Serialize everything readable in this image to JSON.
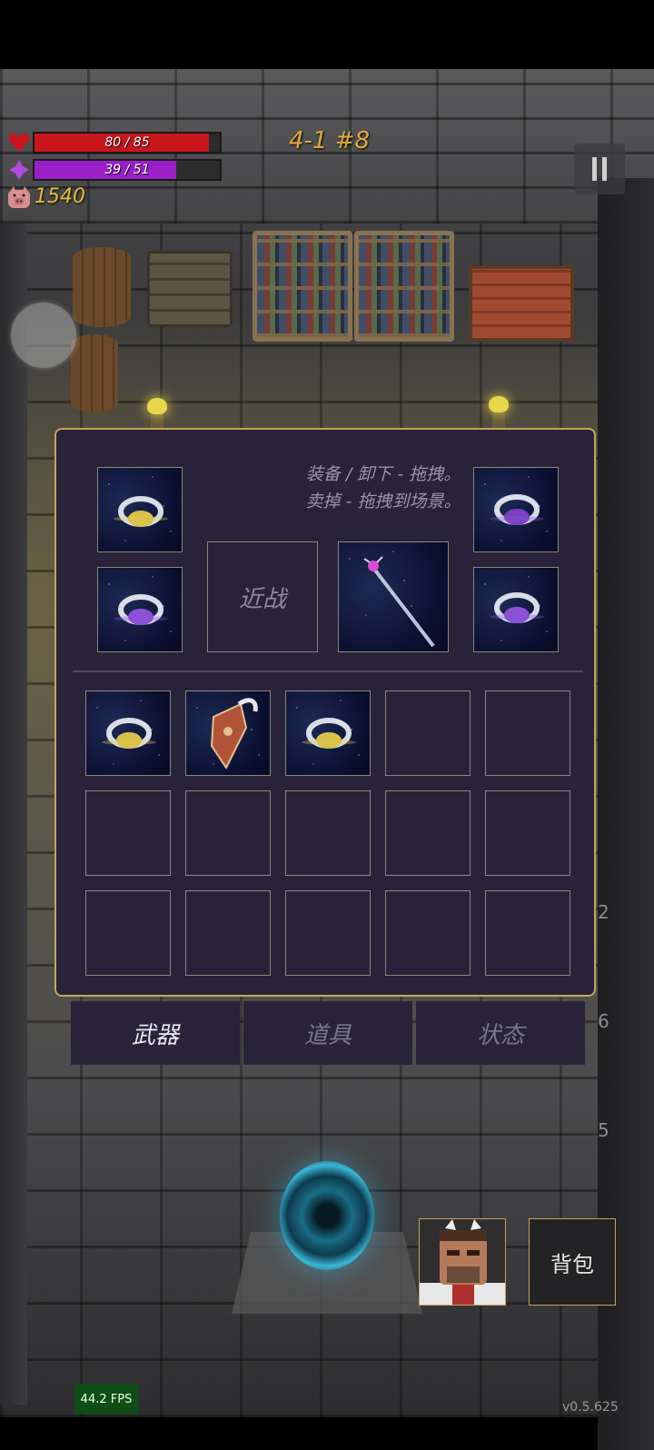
{
  "hud": {
    "hp_text": "80 / 85",
    "hp_fraction": 0.941,
    "hp_color": "#c8161c",
    "mana_text": "39 / 51",
    "mana_fraction": 0.765,
    "mana_color": "#9a1fc8",
    "gold": "1540",
    "level": "4-1 #8"
  },
  "inventory": {
    "hint_line1": "装备 / 卸下 - 拖拽。",
    "hint_line2": "卖掉 - 拖拽到场景。",
    "melee_label": "近战",
    "equipped": [
      {
        "slot": "ring-top-left",
        "icon": "ring-yellow-icon"
      },
      {
        "slot": "ring-bottom-left",
        "icon": "ring-purple-icon"
      },
      {
        "slot": "weapon",
        "icon": "magic-staff-icon"
      },
      {
        "slot": "ring-top-right",
        "icon": "ring-purple-icon"
      },
      {
        "slot": "ring-bottom-right",
        "icon": "ring-purple-icon"
      }
    ],
    "bag_items": [
      {
        "icon": "ring-yellow-icon"
      },
      {
        "icon": "winged-shield-icon"
      },
      {
        "icon": "ring-yellow-icon"
      }
    ],
    "bag_total_slots": 15
  },
  "tabs": [
    {
      "label": "武器",
      "active": true
    },
    {
      "label": "道具",
      "active": false
    },
    {
      "label": "状态",
      "active": false
    }
  ],
  "side_numbers": [
    "2",
    "6",
    "5"
  ],
  "bag_button": "背包",
  "fps": "44.2 FPS",
  "version": "v0.5.625"
}
